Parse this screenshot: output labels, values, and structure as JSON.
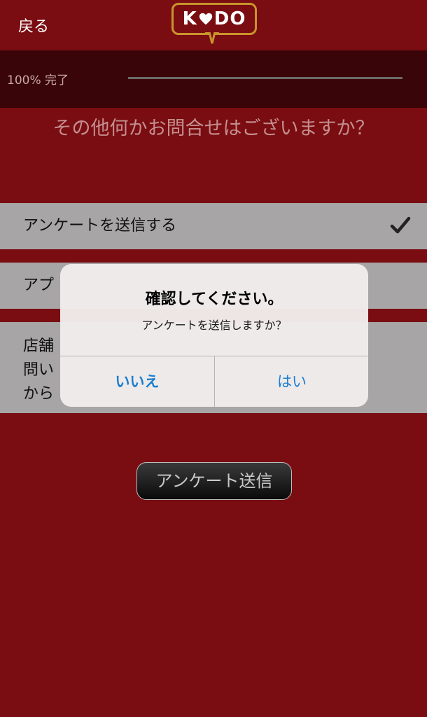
{
  "header": {
    "back_label": "戻る",
    "logo_left": "K",
    "logo_right": "DO"
  },
  "progress": {
    "label": "100% 完了",
    "value": 100
  },
  "question": {
    "text": "その他何かお問合せはございますか？"
  },
  "options": [
    {
      "label": "アンケートを送信する",
      "checked": true
    },
    {
      "label": "アプ",
      "checked": false
    },
    {
      "label_lines": [
        "店舗",
        "問い",
        "から"
      ],
      "checked": false
    }
  ],
  "submit": {
    "label": "アンケート送信"
  },
  "alert": {
    "title": "確認してください。",
    "message": "アンケートを送信しますか？",
    "no_label": "いいえ",
    "yes_label": "はい"
  },
  "colors": {
    "background": "#7a0d12",
    "progress_bg": "#3a0508",
    "option_bg": "#a7a5a5",
    "logo_border": "#c9942c",
    "alert_button": "#1a7fd1"
  }
}
